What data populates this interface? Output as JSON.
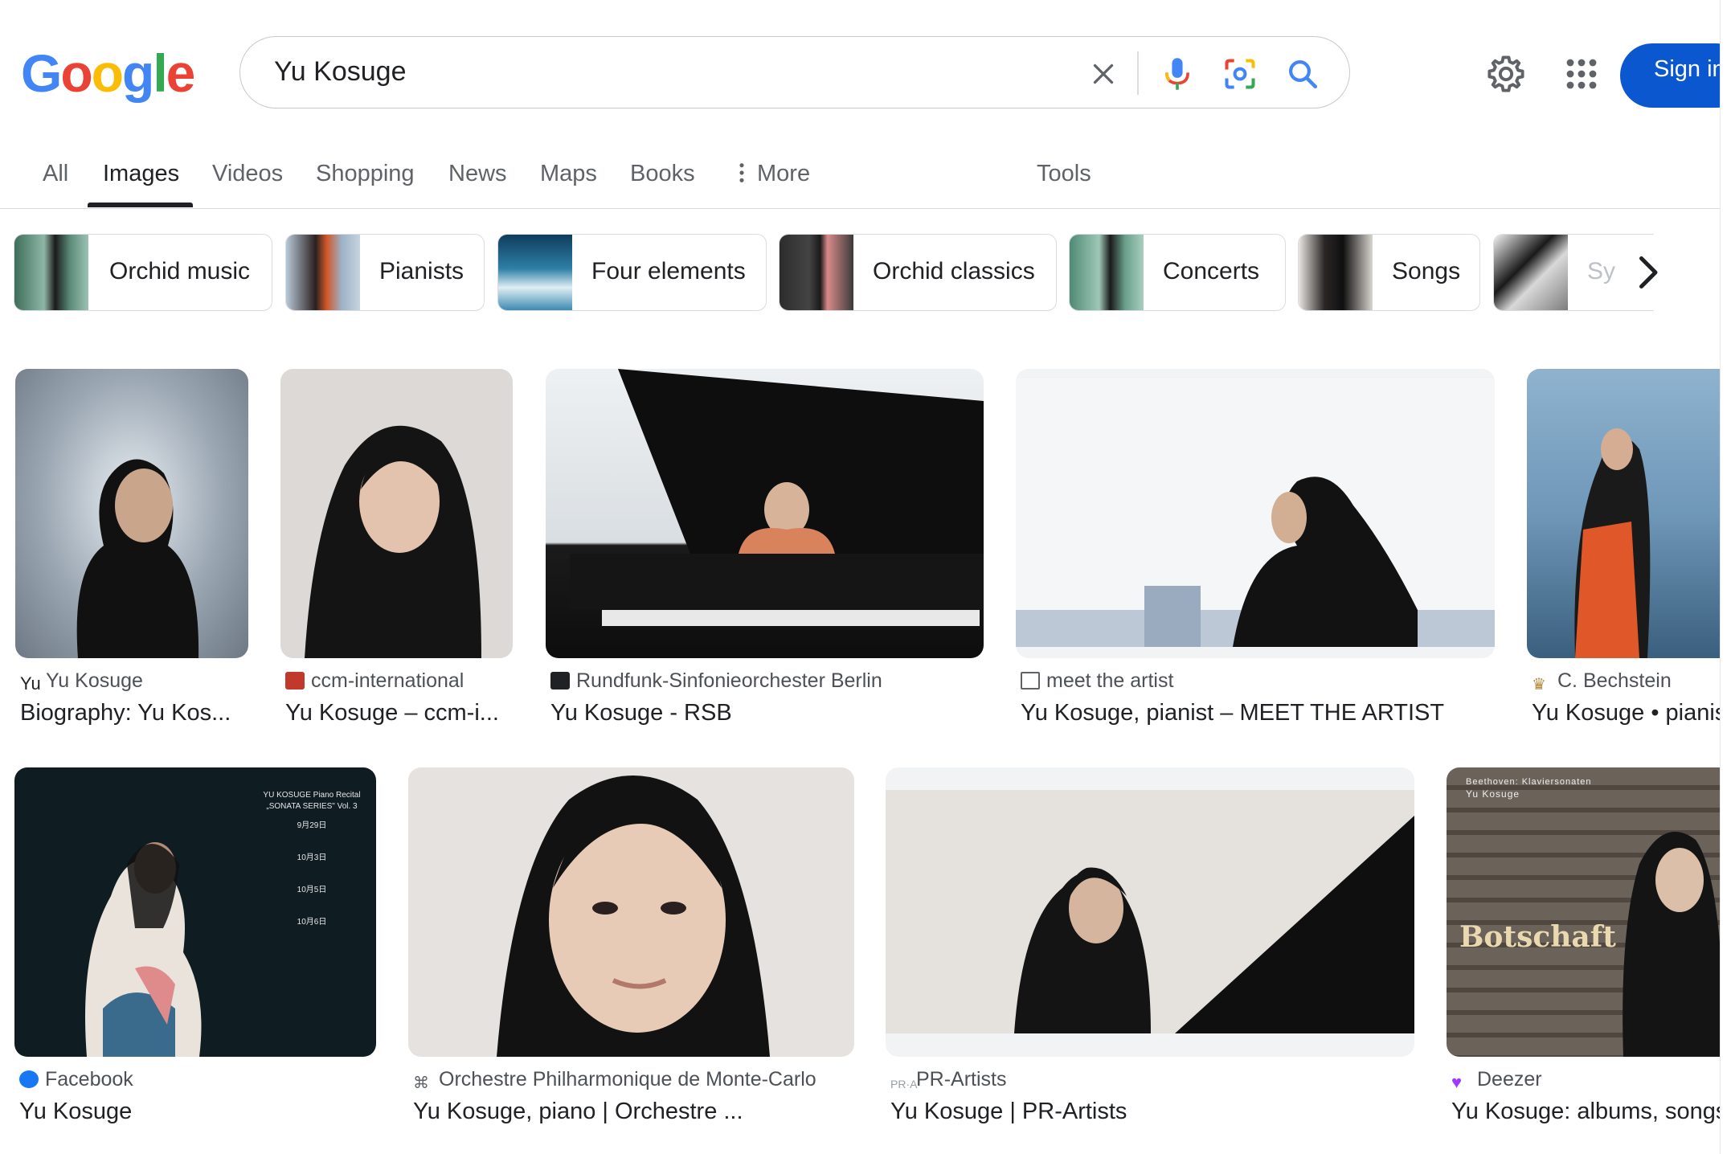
{
  "logo": {
    "letters": [
      "G",
      "o",
      "o",
      "g",
      "l",
      "e"
    ]
  },
  "search": {
    "query": "Yu Kosuge"
  },
  "icons": {
    "clear": "close-icon",
    "voice": "microphone-icon",
    "lens": "camera-lens-icon",
    "submit": "search-icon",
    "settings": "gear-icon",
    "apps": "apps-grid-icon",
    "more": "vertical-dots-icon",
    "chips_next": "chevron-right-icon"
  },
  "header": {
    "signin_label": "Sign in"
  },
  "tabs": [
    {
      "label": "All"
    },
    {
      "label": "Images",
      "active": true
    },
    {
      "label": "Videos"
    },
    {
      "label": "Shopping"
    },
    {
      "label": "News"
    },
    {
      "label": "Maps"
    },
    {
      "label": "Books"
    },
    {
      "label": "More"
    },
    {
      "label": "Tools"
    }
  ],
  "chips": [
    {
      "label": "Orchid music"
    },
    {
      "label": "Pianists"
    },
    {
      "label": "Four elements"
    },
    {
      "label": "Orchid classics"
    },
    {
      "label": "Concerts"
    },
    {
      "label": "Songs"
    },
    {
      "label": "Sy"
    }
  ],
  "results": [
    {
      "source": "Yu Kosuge",
      "title": "Biography: Yu Kos..."
    },
    {
      "source": "ccm-international",
      "title": "Yu Kosuge – ccm-i..."
    },
    {
      "source": "Rundfunk-Sinfonieorchester Berlin",
      "title": "Yu Kosuge - RSB"
    },
    {
      "source": "meet the artist",
      "title": "Yu Kosuge, pianist – MEET THE ARTIST"
    },
    {
      "source": "C. Bechstein",
      "title": "Yu Kosuge • pianis"
    },
    {
      "source": "Facebook",
      "title": "Yu Kosuge"
    },
    {
      "source": "Orchestre Philharmonique de Monte-Carlo",
      "title": "Yu Kosuge, piano | Orchestre ..."
    },
    {
      "source": "PR-Artists",
      "title": "Yu Kosuge | PR-Artists"
    },
    {
      "source": "Deezer",
      "title": "Yu Kosuge: albums, songs"
    }
  ],
  "image_text": {
    "facebook_poster": [
      "YU KOSUGE Piano Recital",
      "„SONATA SERIES\" Vol. 3",
      "9月29日",
      "10月3日",
      "10月5日",
      "10月6日"
    ],
    "deezer_cover_top": "Beethoven: Klaviersonaten",
    "deezer_cover_artist": "Yu Kosuge",
    "deezer_cover_title": "Botschaft"
  },
  "colors": {
    "brand_blue": "#4285F4",
    "brand_red": "#EA4335",
    "brand_yellow": "#FBBC05",
    "brand_green": "#34A853",
    "signin_bg": "#0b57d0",
    "active_tab": "#202124",
    "muted_text": "#5f6368"
  }
}
